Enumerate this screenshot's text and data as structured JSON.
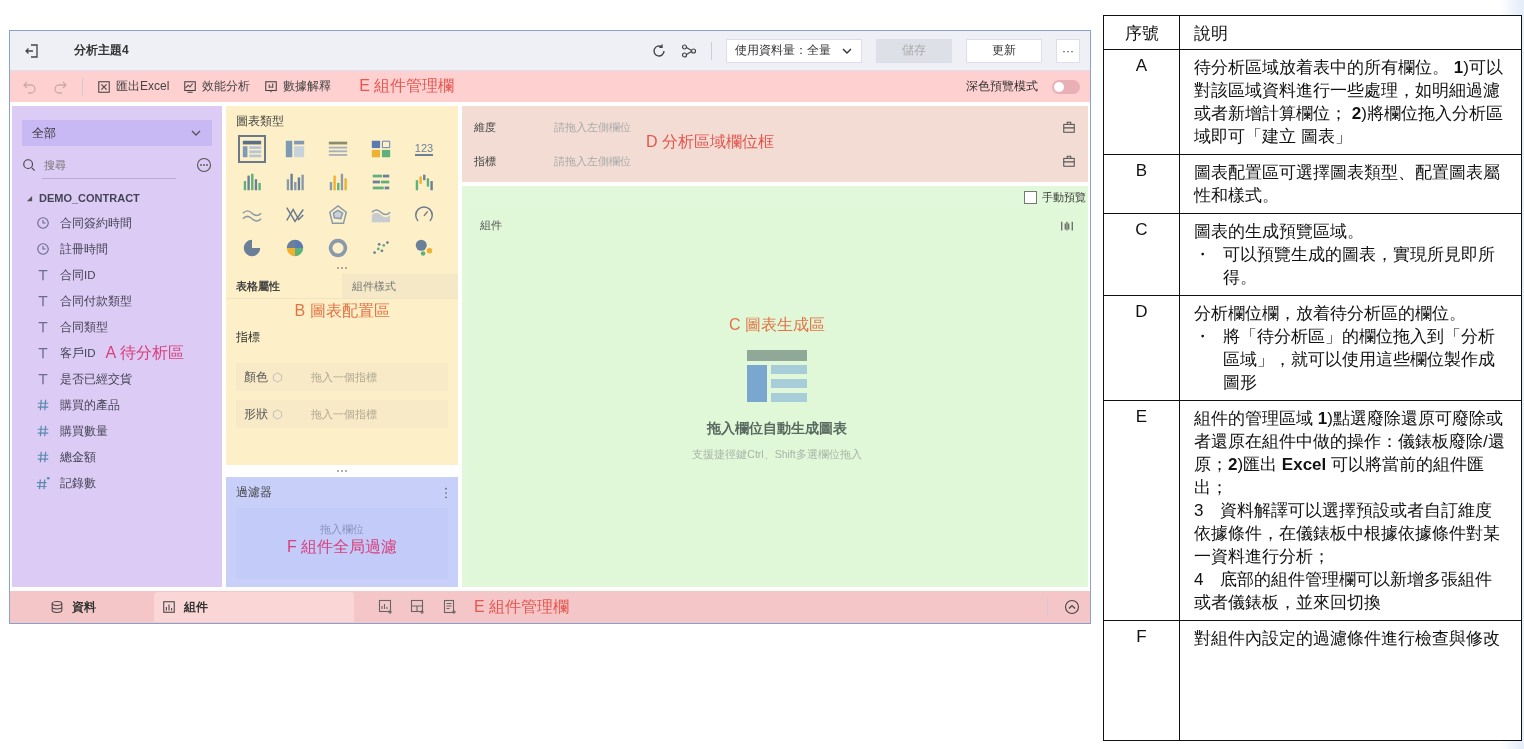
{
  "header": {
    "title": "分析主題4",
    "data_select": "使用資料量：全量",
    "buttons": [
      {
        "label": "儲存",
        "disabled": true
      },
      {
        "label": "更新",
        "disabled": false
      }
    ],
    "more": "···"
  },
  "toolbar": {
    "undo_disabled": true,
    "redo_disabled": true,
    "actions": [
      {
        "kind": "excel",
        "label": "匯出Excel"
      },
      {
        "kind": "performance",
        "label": "效能分析"
      },
      {
        "kind": "explain",
        "label": "數據解釋"
      }
    ],
    "annotation": "E 組件管理欄",
    "dark_preview": {
      "label": "深色預覽模式",
      "on": false
    }
  },
  "fields_panel": {
    "scope": "全部",
    "search_placeholder": "搜尋",
    "tree": [
      {
        "label": "DEMO_CONTRACT",
        "expanded": true,
        "children": [
          {
            "label": "合同簽約時間",
            "kind": "time"
          },
          {
            "label": "註冊時間",
            "kind": "time"
          },
          {
            "label": "合同ID",
            "kind": "text"
          },
          {
            "label": "合同付款類型",
            "kind": "text"
          },
          {
            "label": "合同類型",
            "kind": "text"
          },
          {
            "label": "客戶ID",
            "kind": "text",
            "annotation": "A 待分析區"
          },
          {
            "label": "是否已經交貨",
            "kind": "text"
          },
          {
            "label": "購買的產品",
            "kind": "number"
          },
          {
            "label": "購買數量",
            "kind": "number"
          },
          {
            "label": "總金額",
            "kind": "number"
          },
          {
            "label": "記錄數",
            "kind": "count"
          }
        ]
      }
    ]
  },
  "chart_config": {
    "title": "圖表類型",
    "types": [
      {
        "kind": "table",
        "selected": true
      },
      {
        "kind": "pivot",
        "selected": false
      },
      {
        "kind": "detail",
        "selected": false
      },
      {
        "kind": "tiles",
        "selected": false
      },
      {
        "kind": "number",
        "label": "123",
        "selected": false
      },
      {
        "kind": "dotbar",
        "selected": false
      },
      {
        "kind": "bar",
        "selected": false
      },
      {
        "kind": "bar2",
        "selected": false
      },
      {
        "kind": "hbar",
        "selected": false
      },
      {
        "kind": "waterfall",
        "selected": false
      },
      {
        "kind": "line",
        "selected": false
      },
      {
        "kind": "crossline",
        "selected": false
      },
      {
        "kind": "radar",
        "selected": false
      },
      {
        "kind": "area",
        "selected": false
      },
      {
        "kind": "gauge",
        "selected": false
      },
      {
        "kind": "pie",
        "selected": false
      },
      {
        "kind": "multipie",
        "selected": false
      },
      {
        "kind": "donut",
        "selected": false
      },
      {
        "kind": "scatter",
        "selected": false
      },
      {
        "kind": "bubble",
        "selected": false
      }
    ],
    "tabs": [
      {
        "label": "表格屬性",
        "selected": true
      },
      {
        "label": "組件樣式",
        "selected": false
      }
    ],
    "annotation": "B 圖表配置區",
    "section": "指標",
    "slots": [
      {
        "label": "顏色",
        "placeholder": "拖入一個指標"
      },
      {
        "label": "形狀",
        "placeholder": "拖入一個指標"
      }
    ]
  },
  "filter": {
    "title": "過濾器",
    "drop_hint": "拖入欄位",
    "annotation": "F 組件全局過濾"
  },
  "analysis_fields": {
    "rows": [
      {
        "label": "維度",
        "placeholder": "請拖入左側欄位"
      },
      {
        "label": "指標",
        "placeholder": "請拖入左側欄位"
      }
    ],
    "annotation": "D 分析區域欄位框"
  },
  "preview": {
    "manual_preview": {
      "label": "手動預覽",
      "checked": false
    },
    "card_title": "組件",
    "annotation": "C 圖表生成區",
    "empty_title": "拖入欄位自動生成圖表",
    "empty_hint": "支援捷徑鍵Ctrl、Shift多選欄位拖入"
  },
  "bottom_bar": {
    "tabs": [
      {
        "kind": "data",
        "label": "資料",
        "selected": false
      },
      {
        "kind": "component",
        "label": "組件",
        "selected": true
      }
    ],
    "annotation": "E 組件管理欄"
  },
  "legend_table": {
    "columns": [
      "序號",
      "說明"
    ],
    "rows": [
      {
        "id": "A",
        "paragraphs": [
          {
            "kind": "text",
            "text": "待分析區域放着表中的所有欄位。 **1**)可以對該區域資料進行一些處理，如明細過濾或者新增計算欄位； **2**)將欄位拖入分析區域即可「建立 圖表」"
          }
        ]
      },
      {
        "id": "B",
        "paragraphs": [
          {
            "kind": "text",
            "text": "圖表配置區可選擇圖表類型、配置圖表屬性和樣式。"
          }
        ]
      },
      {
        "id": "C",
        "paragraphs": [
          {
            "kind": "text",
            "text": "圖表的生成預覽區域。"
          },
          {
            "kind": "bullet",
            "mark": "・",
            "text": "可以預覽生成的圖表，實現所見即所得。"
          }
        ]
      },
      {
        "id": "D",
        "paragraphs": [
          {
            "kind": "text",
            "text": "分析欄位欄，放着待分析區的欄位。"
          },
          {
            "kind": "bullet",
            "mark": "・",
            "text": "將「待分析區」的欄位拖入到「分析區域」，就可以使用這些欄位製作成圖形"
          }
        ]
      },
      {
        "id": "E",
        "paragraphs": [
          {
            "kind": "text",
            "text": "組件的管理區域 **1**)點選廢除還原可廢除或者還原在組件中做的操作：儀錶板廢除/還原；**2**)匯出 **Excel** 可以將當前的組件匯出；"
          },
          {
            "kind": "text",
            "text": "3　資料解譯可以選擇預設或者自訂維度依據條件，在儀錶板中根據依據條件對某一資料進行分析；"
          },
          {
            "kind": "text",
            "text": "4　底部的組件管理欄可以新增多張組件或者儀錶板，並來回切換"
          }
        ]
      },
      {
        "id": "F",
        "paragraphs": [
          {
            "kind": "text",
            "text": "對組件內設定的過濾條件進行檢查與修改"
          }
        ]
      }
    ]
  }
}
